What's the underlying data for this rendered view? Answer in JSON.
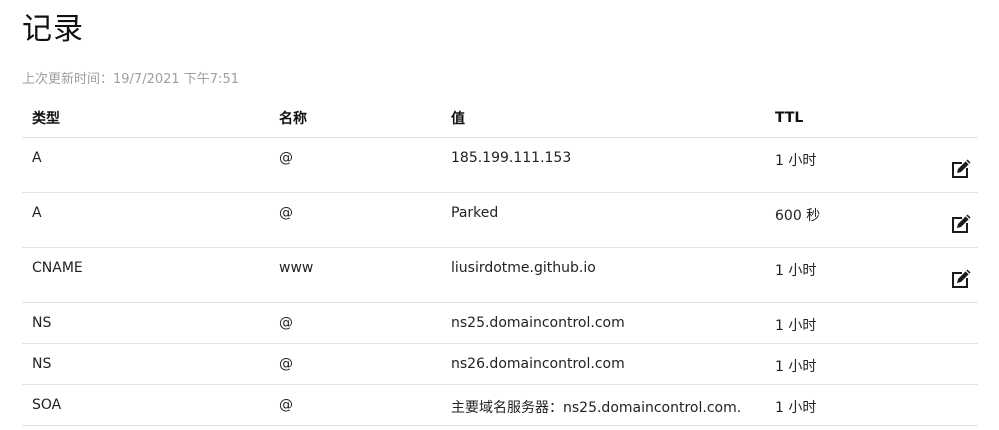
{
  "page": {
    "title": "记录",
    "last_updated": "上次更新时间：19/7/2021 下午7:51"
  },
  "table": {
    "headers": {
      "type": "类型",
      "name": "名称",
      "value": "值",
      "ttl": "TTL"
    },
    "rows": [
      {
        "type": "A",
        "name": "@",
        "value": "185.199.111.153",
        "ttl": "1 小时",
        "editable": true
      },
      {
        "type": "A",
        "name": "@",
        "value": "Parked",
        "ttl": "600 秒",
        "editable": true
      },
      {
        "type": "CNAME",
        "name": "www",
        "value": "liusirdotme.github.io",
        "ttl": "1 小时",
        "editable": true
      },
      {
        "type": "NS",
        "name": "@",
        "value": "ns25.domaincontrol.com",
        "ttl": "1 小时",
        "editable": false
      },
      {
        "type": "NS",
        "name": "@",
        "value": "ns26.domaincontrol.com",
        "ttl": "1 小时",
        "editable": false
      },
      {
        "type": "SOA",
        "name": "@",
        "value": "主要域名服务器：ns25.domaincontrol.com.",
        "ttl": "1 小时",
        "editable": false
      }
    ]
  },
  "icons": {
    "edit": "edit-icon"
  },
  "colors": {
    "text": "#222222",
    "muted": "#9e9e9e",
    "divider": "#e3e3e3",
    "icon": "#1b1b1b"
  }
}
